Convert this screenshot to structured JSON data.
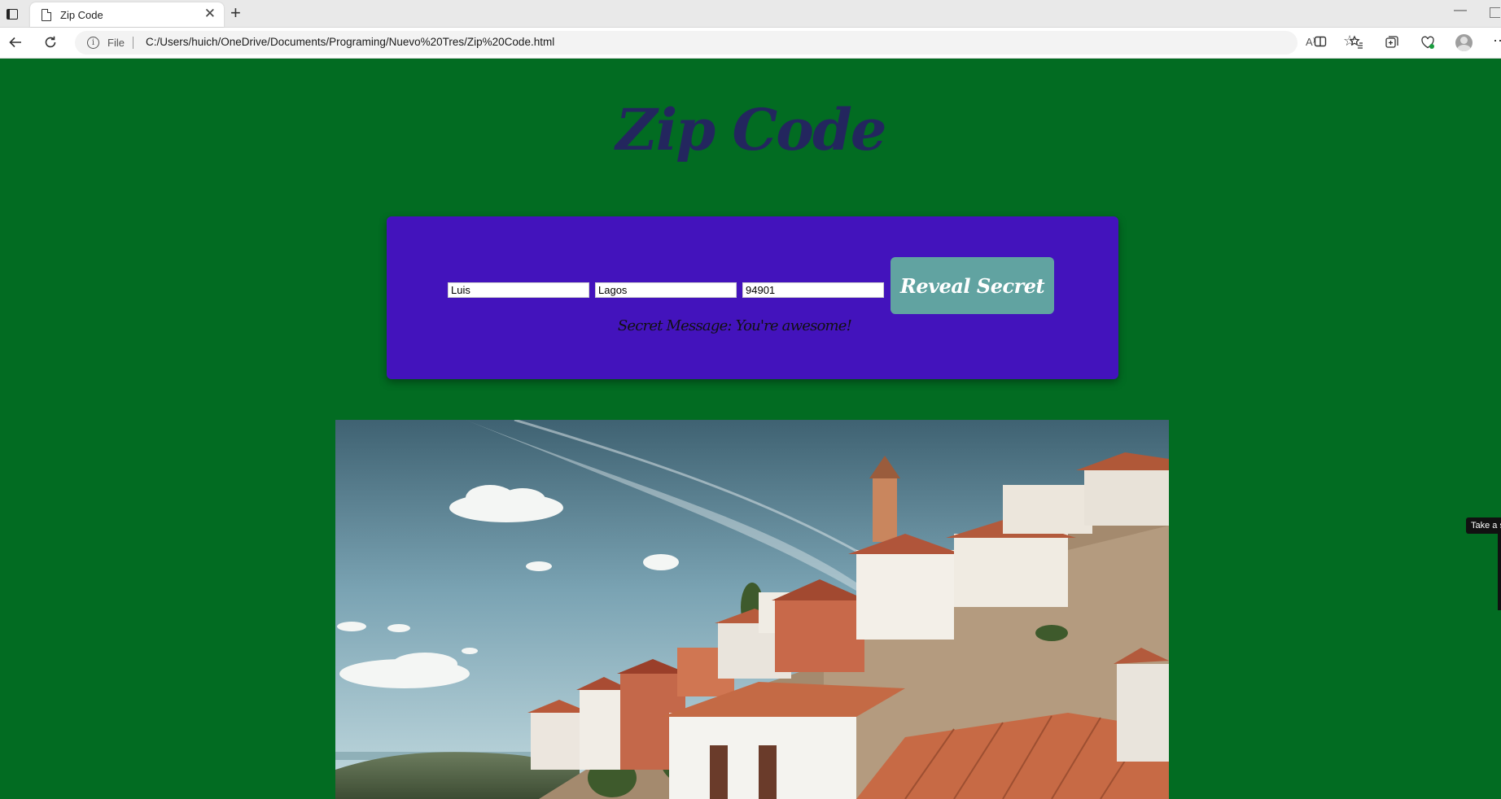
{
  "browser": {
    "tab_title": "Zip Code",
    "tab_close": "✕",
    "new_tab": "+",
    "file_label": "File",
    "url": "C:/Users/huich/OneDrive/Documents/Programing/Nuevo%20Tres/Zip%20Code.html",
    "read_aloud": "A⁾",
    "min": "—"
  },
  "page": {
    "title": "Zip Code",
    "inputs": {
      "first_name": "Luis",
      "last_name": "Lagos",
      "zip": "94901"
    },
    "button_label": "Reveal Secret",
    "secret_message": "Secret Message: You're awesome!"
  },
  "tooltip": "Take a s",
  "colors": {
    "page_bg": "#026c22",
    "card_bg": "#4313bc",
    "title": "#23265e",
    "button": "#61a3a1"
  }
}
